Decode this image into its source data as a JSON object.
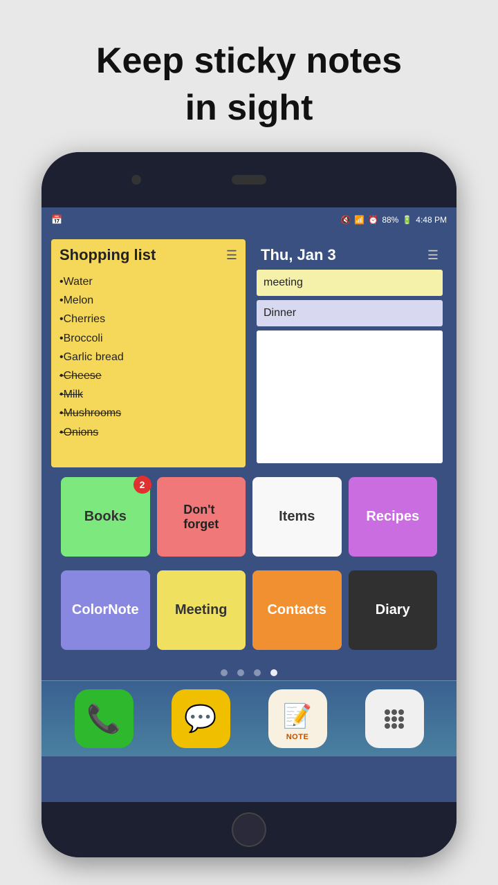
{
  "header": {
    "line1": "Keep sticky notes",
    "line2": "in sight"
  },
  "status_bar": {
    "left_icon": "📅",
    "mute_icon": "🔇",
    "wifi_icon": "📶",
    "alarm_icon": "⏰",
    "battery": "88%",
    "time": "4:48 PM"
  },
  "shopping_note": {
    "title": "Shopping list",
    "items": [
      {
        "text": "•Water",
        "strikethrough": false
      },
      {
        "text": "•Melon",
        "strikethrough": false
      },
      {
        "text": "•Cherries",
        "strikethrough": false
      },
      {
        "text": "•Broccoli",
        "strikethrough": false
      },
      {
        "text": "•Garlic bread",
        "strikethrough": false
      },
      {
        "text": "•Cheese",
        "strikethrough": true
      },
      {
        "text": "•Milk",
        "strikethrough": true
      },
      {
        "text": "•Mushrooms",
        "strikethrough": true
      },
      {
        "text": "•Onions",
        "strikethrough": true
      }
    ]
  },
  "calendar_note": {
    "title": "Thu, Jan 3",
    "meeting": "meeting",
    "dinner": "Dinner"
  },
  "app_icons_row1": [
    {
      "label": "Books",
      "color_class": "icon-books"
    },
    {
      "label": "Don't forget",
      "color_class": "icon-dontforget"
    },
    {
      "label": "Items",
      "color_class": "icon-items"
    },
    {
      "label": "Recipes",
      "color_class": "icon-recipes"
    }
  ],
  "app_icons_row2": [
    {
      "label": "ColorNote",
      "color_class": "icon-colornote"
    },
    {
      "label": "Meeting",
      "color_class": "icon-meeting"
    },
    {
      "label": "Contacts",
      "color_class": "icon-contacts"
    },
    {
      "label": "Diary",
      "color_class": "icon-diary"
    }
  ],
  "badge_count": "2",
  "dock_icons": [
    {
      "label": "Phone",
      "emoji": "📞",
      "color_class": "dock-phone"
    },
    {
      "label": "Messages",
      "emoji": "💬",
      "color_class": "dock-msg"
    },
    {
      "label": "ColorNote",
      "emoji": "📝",
      "color_class": "dock-note"
    },
    {
      "label": "Apps",
      "emoji": "⋮⋮⋮",
      "color_class": "dock-apps"
    }
  ],
  "note_label": "NOTE"
}
